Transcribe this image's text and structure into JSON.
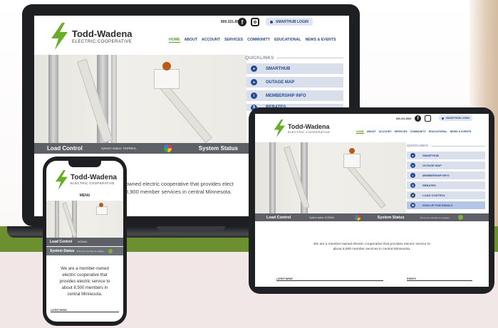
{
  "brand": {
    "name": "Todd-Wadena",
    "tagline": "ELECTRIC COOPERATIVE"
  },
  "header": {
    "phone": "800.321.8932",
    "smarthub_login": "SMARTHUB LOGIN",
    "social_icons": [
      "facebook-icon",
      "instagram-icon"
    ]
  },
  "nav": {
    "items": [
      "HOME",
      "ABOUT",
      "ACCOUNT",
      "SERVICES",
      "COMMUNITY",
      "EDUCATIONAL",
      "NEWS & EVENTS"
    ],
    "active": "HOME"
  },
  "quicklinks": {
    "title": "QUICKLINKS",
    "items": [
      {
        "label": "SMARTHUB",
        "icon": "eye-icon"
      },
      {
        "label": "OUTAGE MAP",
        "icon": "map-pin-icon"
      },
      {
        "label": "MEMBERSHIP INFO",
        "icon": "info-icon"
      },
      {
        "label": "REBATES",
        "icon": "rebate-icon"
      },
      {
        "label": "LOAD CONTROL",
        "icon": "load-icon"
      },
      {
        "label": "SIGN UP FOR EMAILS",
        "icon": "email-icon"
      }
    ],
    "laptop_partial": "REBATES"
  },
  "status": {
    "load_control": "Load Control",
    "system_status_label": "System status: NORMAL",
    "system_status": "System Status",
    "no_outages": "There are currently no outages."
  },
  "intro": {
    "laptop_line1": "owned electric cooperative that provides elect",
    "laptop_line2": "8,900 member services in central Minnesota.",
    "tablet_line1": "We are a member-owned electric cooperative that provides electric service to",
    "tablet_line2": "about 8,900 member services in central Minnesota.",
    "phone_lines": [
      "We are a member-owned",
      "electric cooperative that",
      "provides electric service to",
      "about 8,500 members in",
      "central Minnesota."
    ]
  },
  "sections": {
    "latest_news": "LATEST NEWS",
    "events": "EVENTS"
  },
  "phone": {
    "menu": "MENU",
    "system_status_short": "NORMAL"
  },
  "colors": {
    "accent_green": "#5a9a22",
    "brand_blue": "#294a8c",
    "status_gray": "#5d6066"
  }
}
